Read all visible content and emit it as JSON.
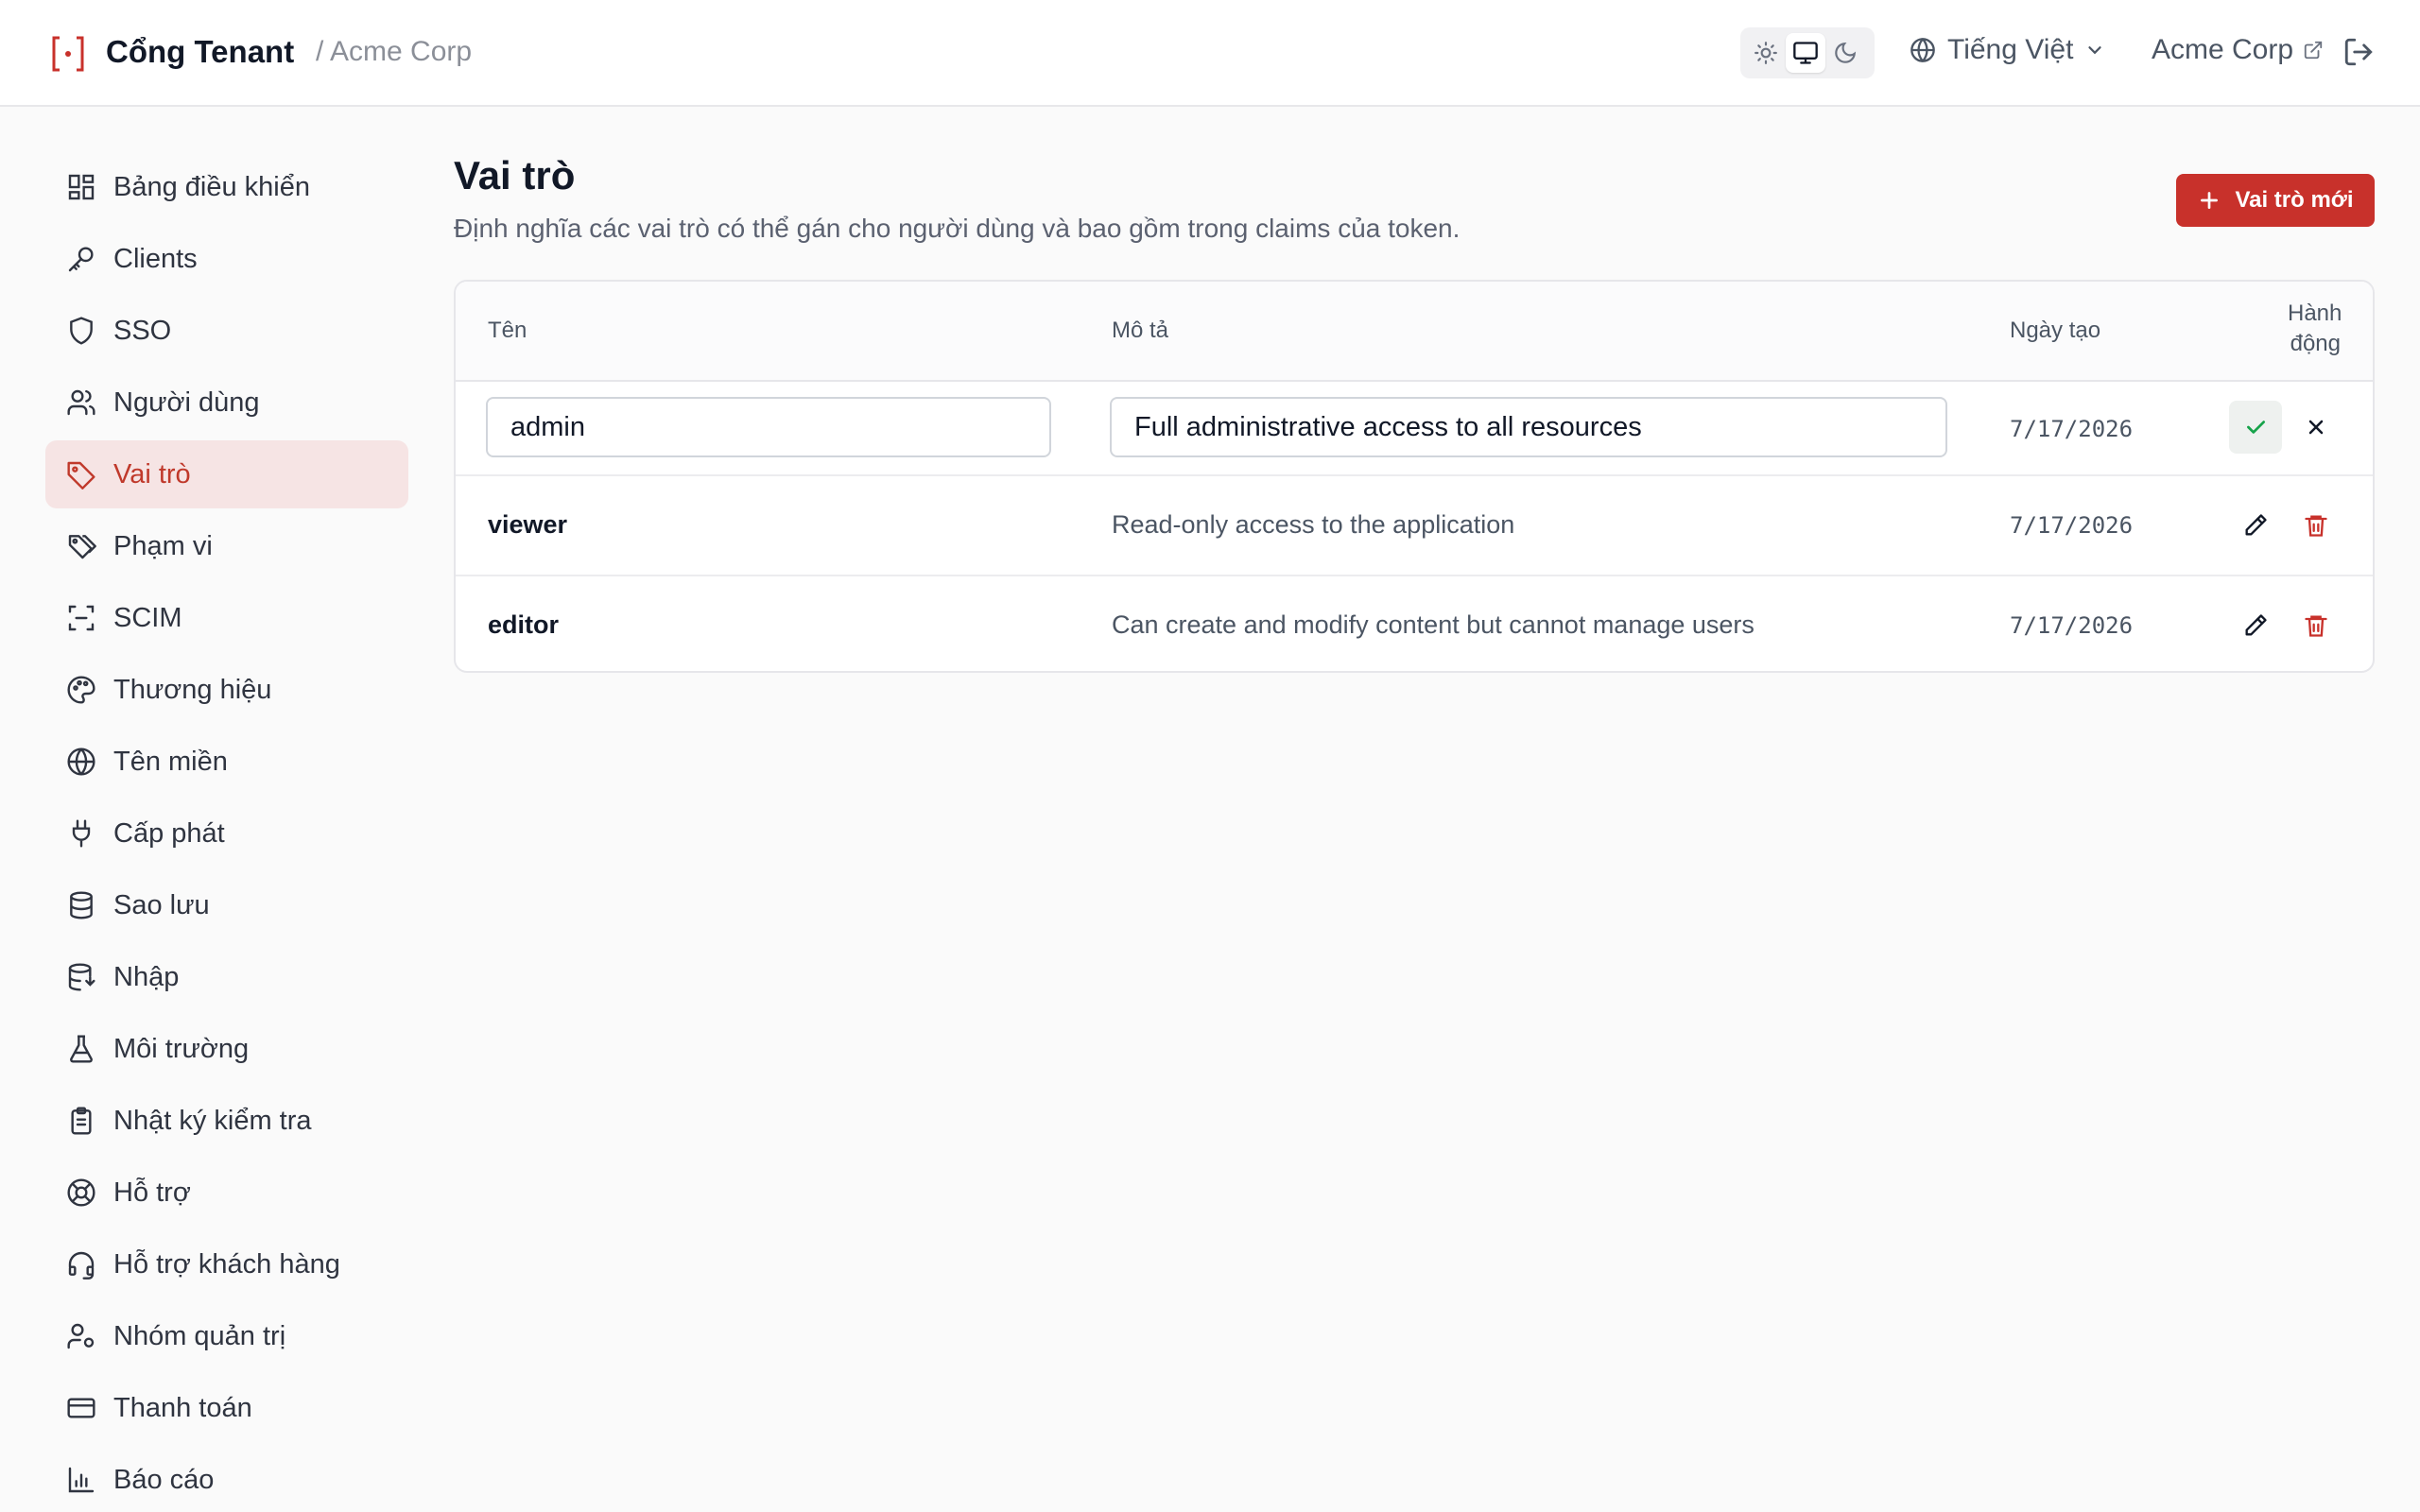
{
  "header": {
    "brand": "Cổng Tenant",
    "tenant_crumb": "/ Acme Corp",
    "theme_modes": [
      "light",
      "system",
      "dark"
    ],
    "theme_active": "system",
    "language": "Tiếng Việt",
    "tenant_link": "Acme Corp"
  },
  "sidebar": {
    "items": [
      {
        "label": "Bảng điều khiển",
        "icon": "dashboard-icon"
      },
      {
        "label": "Clients",
        "icon": "key-icon"
      },
      {
        "label": "SSO",
        "icon": "shield-icon"
      },
      {
        "label": "Người dùng",
        "icon": "users-icon"
      },
      {
        "label": "Vai trò",
        "icon": "tag-icon",
        "active": true
      },
      {
        "label": "Phạm vi",
        "icon": "tags-icon"
      },
      {
        "label": "SCIM",
        "icon": "scan-icon"
      },
      {
        "label": "Thương hiệu",
        "icon": "palette-icon"
      },
      {
        "label": "Tên miền",
        "icon": "globe-icon"
      },
      {
        "label": "Cấp phát",
        "icon": "plug-icon"
      },
      {
        "label": "Sao lưu",
        "icon": "database-icon"
      },
      {
        "label": "Nhập",
        "icon": "database-import-icon"
      },
      {
        "label": "Môi trường",
        "icon": "flask-icon"
      },
      {
        "label": "Nhật ký kiểm tra",
        "icon": "clipboard-icon"
      },
      {
        "label": "Hỗ trợ",
        "icon": "lifebuoy-icon"
      },
      {
        "label": "Hỗ trợ khách hàng",
        "icon": "headset-icon"
      },
      {
        "label": "Nhóm quản trị",
        "icon": "user-cog-icon"
      },
      {
        "label": "Thanh toán",
        "icon": "credit-card-icon"
      },
      {
        "label": "Báo cáo",
        "icon": "bar-chart-icon"
      }
    ]
  },
  "main": {
    "title": "Vai trò",
    "description": "Định nghĩa các vai trò có thể gán cho người dùng và bao gồm trong claims của token.",
    "new_button": "Vai trò mới",
    "table": {
      "columns": {
        "name": "Tên",
        "description": "Mô tả",
        "created": "Ngày tạo",
        "actions_line1": "Hành",
        "actions_line2": "động"
      },
      "editing_row": {
        "name": "admin",
        "description": "Full administrative access to all resources",
        "created": "7/17/2026"
      },
      "rows": [
        {
          "name": "viewer",
          "description": "Read-only access to the application",
          "created": "7/17/2026"
        },
        {
          "name": "editor",
          "description": "Can create and modify content but cannot manage users",
          "created": "7/17/2026"
        }
      ]
    }
  },
  "colors": {
    "accent": "#c8312b",
    "active_bg": "#f6e4e4",
    "success": "#16a34a"
  }
}
